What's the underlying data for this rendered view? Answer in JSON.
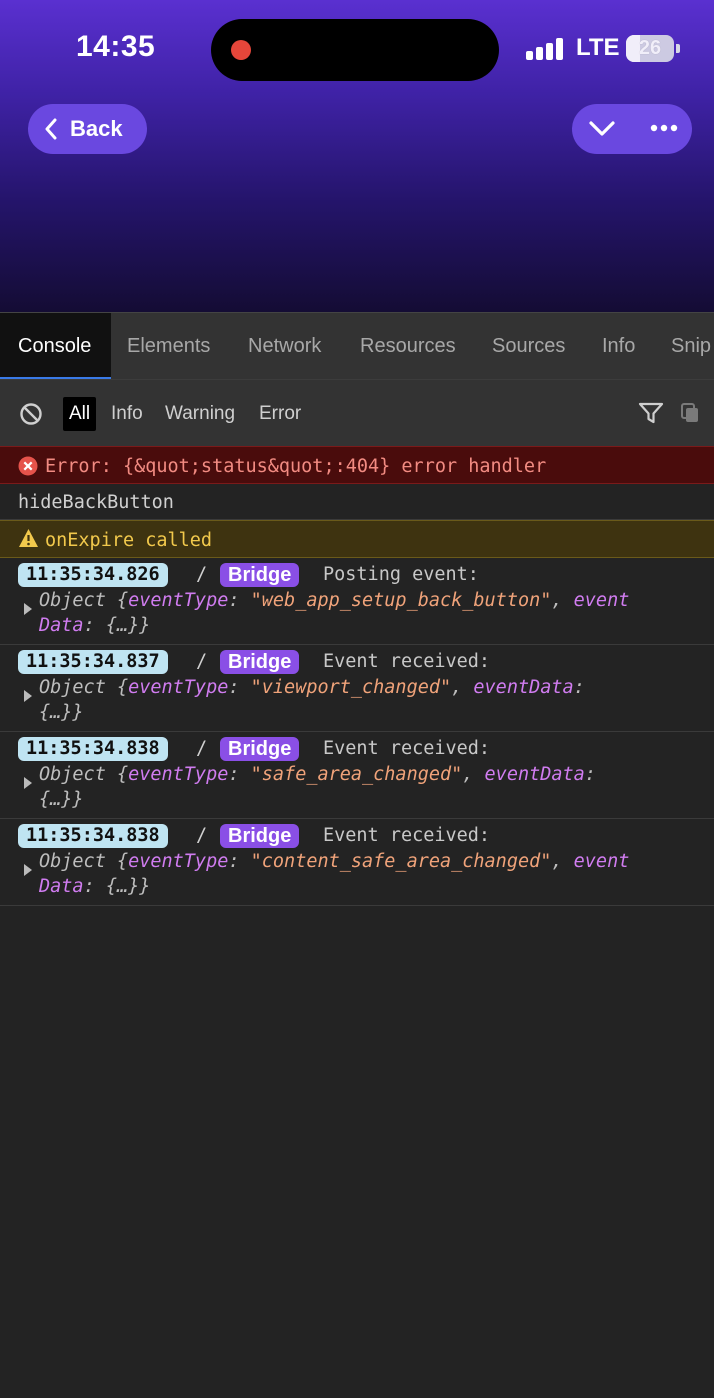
{
  "status_bar": {
    "time": "14:35",
    "network": "LTE",
    "battery": "26"
  },
  "nav": {
    "back_label": "Back"
  },
  "devtools": {
    "tabs": [
      "Console",
      "Elements",
      "Network",
      "Resources",
      "Sources",
      "Info",
      "Snip"
    ],
    "filters": [
      "All",
      "Info",
      "Warning",
      "Error"
    ],
    "logs": {
      "error": "Error: {&quot;status&quot;:404} error handler",
      "plain": "hideBackButton",
      "warning": "onExpire called",
      "entries": [
        {
          "time": "11:35:34.826",
          "tag": "Bridge",
          "message": "Posting event:",
          "obj_line1_a": "Object {",
          "key1": "eventType",
          "colon1": ": ",
          "val1": "\"web_app_setup_back_button\"",
          "sep": ", ",
          "key2a": "event",
          "key2b": "Data",
          "rest": ": {…}}"
        },
        {
          "time": "11:35:34.837",
          "tag": "Bridge",
          "message": "Event received:",
          "obj_line1_a": "Object {",
          "key1": "eventType",
          "colon1": ": ",
          "val1": "\"viewport_changed\"",
          "sep": ", ",
          "key2a": "eventData",
          "key2b": ":",
          "rest": "{…}}"
        },
        {
          "time": "11:35:34.838",
          "tag": "Bridge",
          "message": "Event received:",
          "obj_line1_a": "Object {",
          "key1": "eventType",
          "colon1": ": ",
          "val1": "\"safe_area_changed\"",
          "sep": ", ",
          "key2a": "eventData",
          "key2b": ":",
          "rest": "{…}}"
        },
        {
          "time": "11:35:34.838",
          "tag": "Bridge",
          "message": "Event received:",
          "obj_line1_a": "Object {",
          "key1": "eventType",
          "colon1": ": ",
          "val1": "\"content_safe_area_changed\"",
          "sep": ", ",
          "key2a": "event",
          "key2b": "Data",
          "rest": ": {…}}"
        }
      ]
    }
  },
  "colors": {
    "accent": "#6a48e0",
    "error": "#f28b82",
    "warning": "#f2c94c",
    "timestamp_bg": "#bfe4f2",
    "bridge_bg": "#8a4fe6"
  }
}
